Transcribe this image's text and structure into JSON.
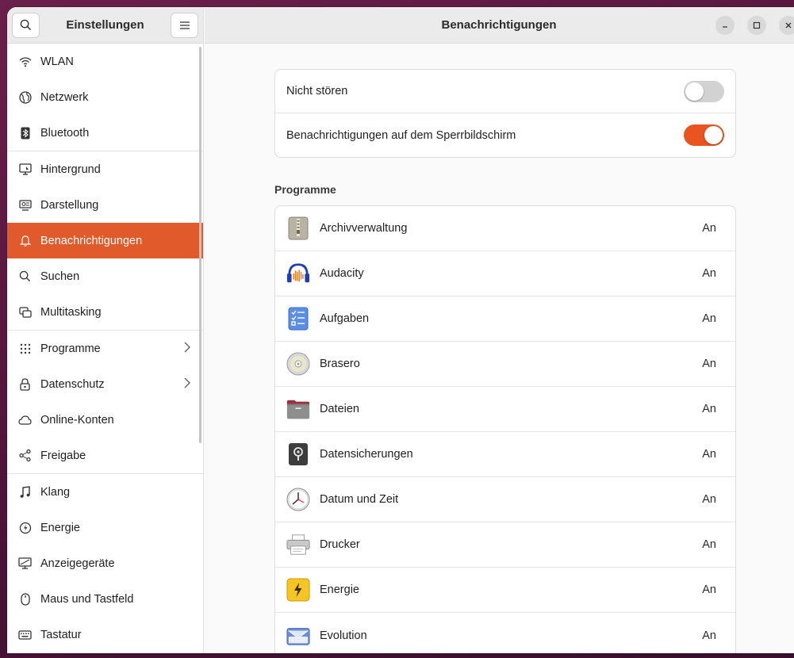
{
  "sidebar": {
    "title": "Einstellungen",
    "items": [
      {
        "label": "WLAN",
        "icon": "wifi-icon"
      },
      {
        "label": "Netzwerk",
        "icon": "globe-icon"
      },
      {
        "label": "Bluetooth",
        "icon": "bluetooth-icon"
      },
      {
        "label": "Hintergrund",
        "icon": "monitor-icon"
      },
      {
        "label": "Darstellung",
        "icon": "appearance-icon"
      },
      {
        "label": "Benachrichtigungen",
        "icon": "bell-icon",
        "active": true
      },
      {
        "label": "Suchen",
        "icon": "search-icon"
      },
      {
        "label": "Multitasking",
        "icon": "multitasking-icon"
      },
      {
        "label": "Programme",
        "icon": "apps-grid-icon",
        "chevron": true
      },
      {
        "label": "Datenschutz",
        "icon": "lock-icon",
        "chevron": true
      },
      {
        "label": "Online-Konten",
        "icon": "cloud-icon"
      },
      {
        "label": "Freigabe",
        "icon": "share-icon"
      },
      {
        "label": "Klang",
        "icon": "music-note-icon"
      },
      {
        "label": "Energie",
        "icon": "power-icon"
      },
      {
        "label": "Anzeigegeräte",
        "icon": "display-icon"
      },
      {
        "label": "Maus und Tastfeld",
        "icon": "mouse-icon"
      },
      {
        "label": "Tastatur",
        "icon": "keyboard-icon"
      }
    ]
  },
  "main": {
    "title": "Benachrichtigungen",
    "toggles": [
      {
        "label": "Nicht stören",
        "state": "off"
      },
      {
        "label": "Benachrichtigungen auf dem Sperrbildschirm",
        "state": "on"
      }
    ],
    "section_title": "Programme",
    "apps": [
      {
        "name": "Archivverwaltung",
        "status": "An",
        "icon": "archive-icon"
      },
      {
        "name": "Audacity",
        "status": "An",
        "icon": "audacity-icon"
      },
      {
        "name": "Aufgaben",
        "status": "An",
        "icon": "tasks-icon"
      },
      {
        "name": "Brasero",
        "status": "An",
        "icon": "disc-icon"
      },
      {
        "name": "Dateien",
        "status": "An",
        "icon": "files-icon"
      },
      {
        "name": "Datensicherungen",
        "status": "An",
        "icon": "backup-icon"
      },
      {
        "name": "Datum und Zeit",
        "status": "An",
        "icon": "clock-icon"
      },
      {
        "name": "Drucker",
        "status": "An",
        "icon": "printer-icon"
      },
      {
        "name": "Energie",
        "status": "An",
        "icon": "energy-icon"
      },
      {
        "name": "Evolution",
        "status": "An",
        "icon": "mail-icon"
      }
    ]
  },
  "colors": {
    "accent": "#e95420",
    "active_bg": "#e05a2b"
  }
}
